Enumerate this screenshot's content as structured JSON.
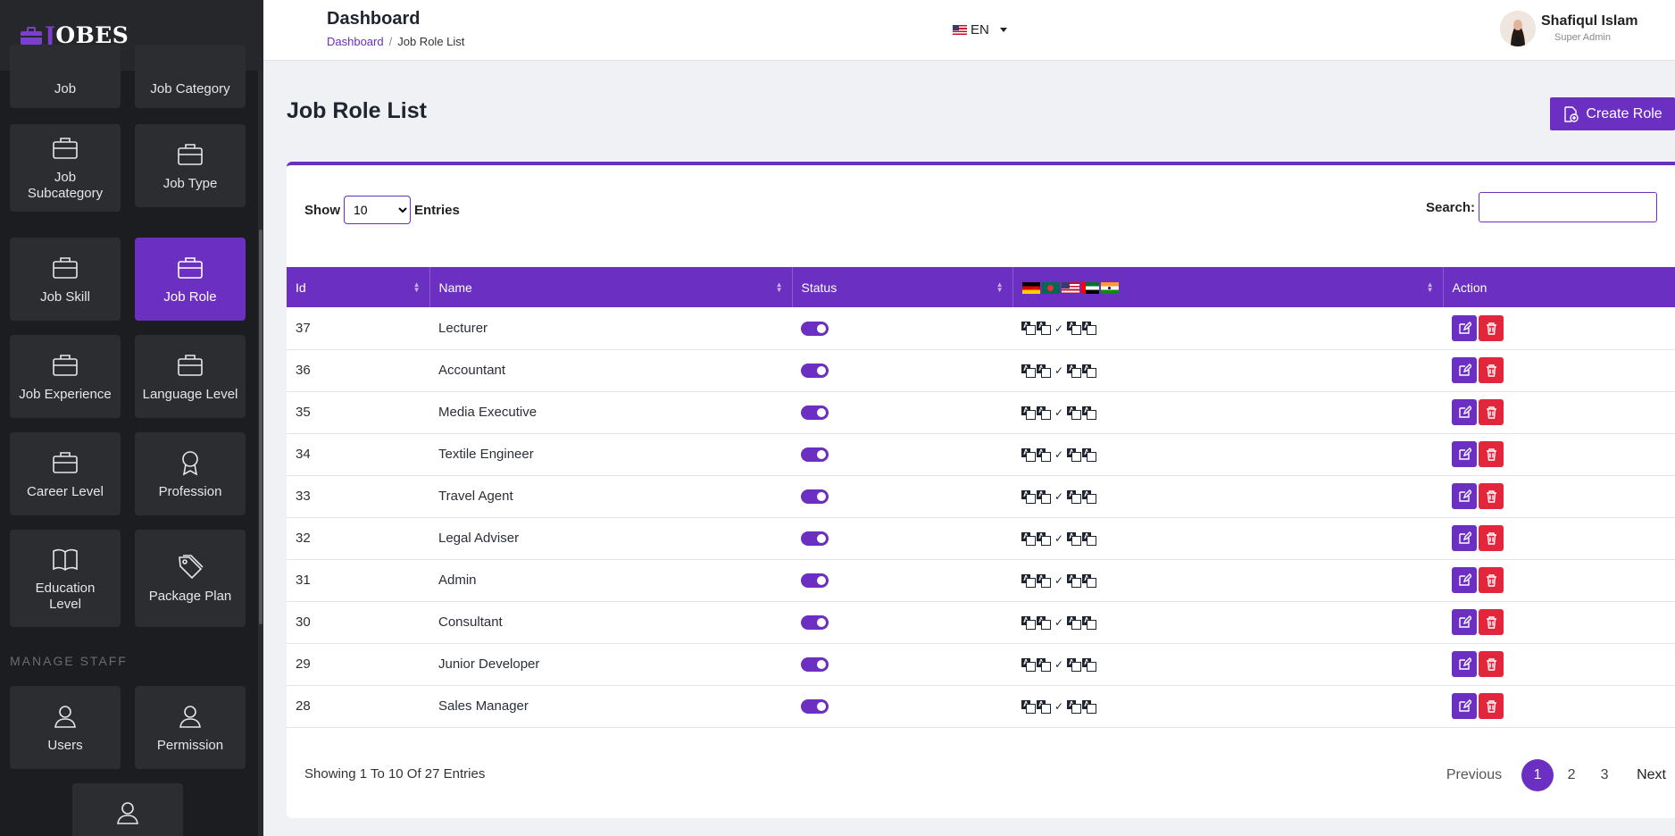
{
  "app": {
    "logo_first": "J",
    "logo_rest": "OBES"
  },
  "sidebar": {
    "tiles": [
      {
        "label": "Job",
        "icon": "briefcase-icon"
      },
      {
        "label": "Job Category",
        "icon": "briefcase-icon"
      },
      {
        "label": "Job Subcategory",
        "icon": "briefcase-icon"
      },
      {
        "label": "Job Type",
        "icon": "briefcase-icon"
      },
      {
        "label": "Job Skill",
        "icon": "briefcase-icon"
      },
      {
        "label": "Job Role",
        "icon": "briefcase-icon",
        "active": true
      },
      {
        "label": "Job Experience",
        "icon": "briefcase-icon"
      },
      {
        "label": "Language Level",
        "icon": "briefcase-icon"
      },
      {
        "label": "Career Level",
        "icon": "briefcase-icon"
      },
      {
        "label": "Profession",
        "icon": "award-icon"
      },
      {
        "label": "Education Level",
        "icon": "book-icon"
      },
      {
        "label": "Package Plan",
        "icon": "tag-icon"
      }
    ],
    "section_title": "MANAGE STAFF",
    "staff_tiles": [
      {
        "label": "Users",
        "icon": "user-icon"
      },
      {
        "label": "Permission",
        "icon": "user-icon"
      }
    ]
  },
  "header": {
    "title": "Dashboard",
    "breadcrumb": {
      "home": "Dashboard",
      "current": "Job Role List"
    },
    "language": "EN",
    "user": {
      "name": "Shafiqul Islam",
      "role": "Super Admin"
    }
  },
  "main": {
    "title": "Job Role List",
    "create_button": "Create Role",
    "show_label": "Show",
    "entries_label": "Entries",
    "entries_value": "10",
    "search_label": "Search:",
    "search_value": "",
    "columns": [
      "Id",
      "Name",
      "Status",
      "",
      "Action"
    ],
    "rows": [
      {
        "id": "37",
        "name": "Lecturer"
      },
      {
        "id": "36",
        "name": "Accountant"
      },
      {
        "id": "35",
        "name": "Media Executive"
      },
      {
        "id": "34",
        "name": "Textile Engineer"
      },
      {
        "id": "33",
        "name": "Travel Agent"
      },
      {
        "id": "32",
        "name": "Legal Adviser"
      },
      {
        "id": "31",
        "name": "Admin"
      },
      {
        "id": "30",
        "name": "Consultant"
      },
      {
        "id": "29",
        "name": "Junior Developer"
      },
      {
        "id": "28",
        "name": "Sales Manager"
      }
    ],
    "showing_text": "Showing 1 To 10 Of 27 Entries",
    "pagination": {
      "previous": "Previous",
      "pages": [
        "1",
        "2",
        "3"
      ],
      "current": "1",
      "next": "Next"
    }
  },
  "colors": {
    "accent": "#6b2fc1",
    "danger": "#e2263b",
    "sidebar_bg": "#1c1d20",
    "tile_bg": "#2c2d31"
  }
}
